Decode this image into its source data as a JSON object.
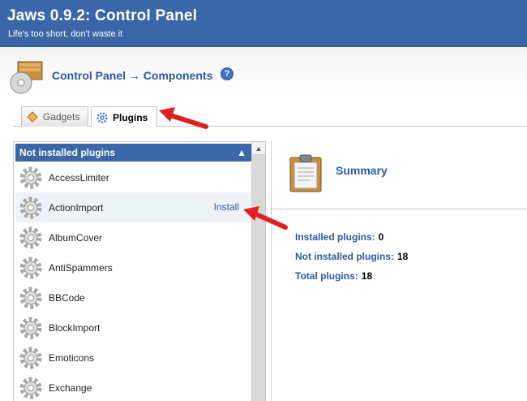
{
  "app": {
    "title": "Jaws 0.9.2: Control Panel",
    "slogan": "Life's too short, don't waste it"
  },
  "breadcrumb": {
    "root": "Control Panel",
    "separator": "→",
    "current": "Components",
    "help_icon": "question-icon"
  },
  "tabs": [
    {
      "label": "Gadgets",
      "icon": "gadget-icon",
      "active": false
    },
    {
      "label": "Plugins",
      "icon": "gear-icon",
      "active": true
    }
  ],
  "plugins_panel": {
    "title": "Not installed plugins",
    "items": [
      {
        "name": "AccessLimiter",
        "hovered": false
      },
      {
        "name": "ActionImport",
        "hovered": true
      },
      {
        "name": "AlbumCover",
        "hovered": false
      },
      {
        "name": "AntiSpammers",
        "hovered": false
      },
      {
        "name": "BBCode",
        "hovered": false
      },
      {
        "name": "BlockImport",
        "hovered": false
      },
      {
        "name": "Emoticons",
        "hovered": false
      },
      {
        "name": "Exchange",
        "hovered": false
      }
    ],
    "install_label": "Install"
  },
  "summary": {
    "title": "Summary",
    "installed_label": "Installed plugins:",
    "installed_value": "0",
    "not_installed_label": "Not installed plugins:",
    "not_installed_value": "18",
    "total_label": "Total plugins:",
    "total_value": "18"
  },
  "colors": {
    "header": "#3b66a7",
    "link": "#2c5a9c",
    "arrow": "#e02020"
  }
}
